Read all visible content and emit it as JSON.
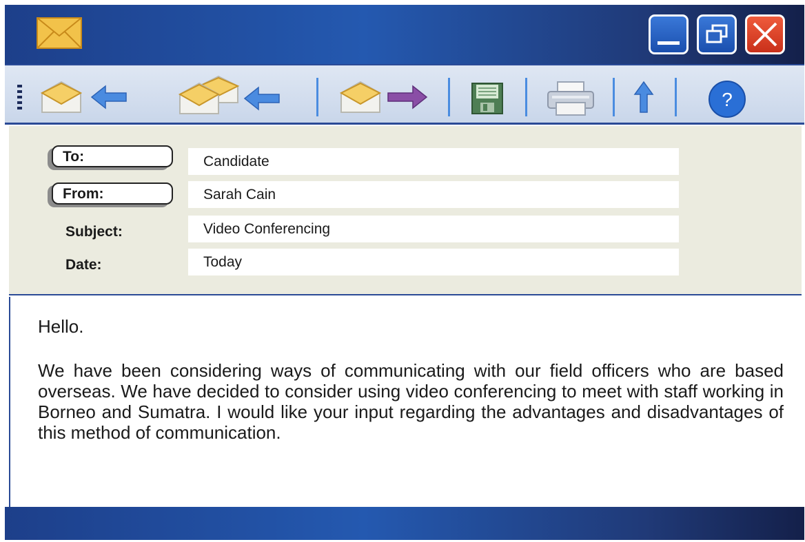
{
  "window": {
    "controls": {
      "minimize_icon": "minimize-icon",
      "restore_icon": "restore-icon",
      "close_icon": "close-icon"
    },
    "colors": {
      "titlebar": "#2459b0",
      "close": "#d93a20",
      "toolbar": "#d4deee",
      "header": "#ebebdf"
    }
  },
  "toolbar": {
    "buttons": [
      {
        "name": "reply",
        "icon": "envelope-arrow-left-icon"
      },
      {
        "name": "reply-all",
        "icon": "envelopes-arrow-left-icon"
      },
      {
        "name": "forward",
        "icon": "envelope-arrow-right-icon"
      },
      {
        "name": "save",
        "icon": "floppy-disk-icon"
      },
      {
        "name": "print",
        "icon": "printer-icon"
      },
      {
        "name": "up",
        "icon": "arrow-up-icon"
      },
      {
        "name": "help",
        "icon": "help-icon",
        "label": "?"
      }
    ]
  },
  "header": {
    "to_label": "To:",
    "to_value": "Candidate",
    "from_label": "From:",
    "from_value": "Sarah Cain",
    "subject_label": "Subject:",
    "subject_value": "Video Conferencing",
    "date_label": "Date:",
    "date_value": "Today"
  },
  "message": {
    "greeting": "Hello.",
    "body": "We have been considering ways of communicating with our field officers who are based overseas. We have decided to consider using video conferencing to meet with staff working in Borneo and Sumatra. I would like your input regarding the advantages and disadvantages of this method of communication."
  }
}
